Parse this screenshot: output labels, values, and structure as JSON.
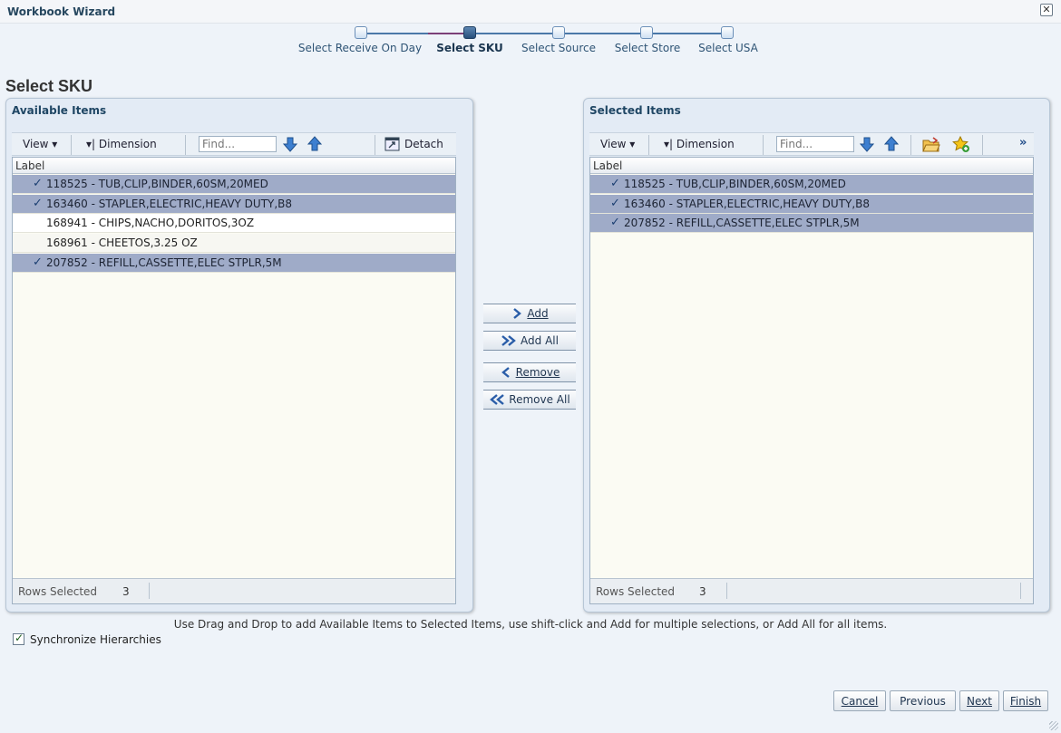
{
  "window": {
    "title": "Workbook Wizard"
  },
  "train": {
    "steps": [
      {
        "label": "Select Receive On Day"
      },
      {
        "label": "Select SKU"
      },
      {
        "label": "Select Source"
      },
      {
        "label": "Select Store"
      },
      {
        "label": "Select USA"
      }
    ],
    "current_step": "Select SKU"
  },
  "page": {
    "title": "Select SKU"
  },
  "available": {
    "title": "Available Items",
    "toolbar": {
      "view": "View ▾",
      "dimension": "Dimension",
      "find_placeholder": "Find...",
      "detach": "Detach"
    },
    "column_header": "Label",
    "rows": [
      {
        "label": "118525 - TUB,CLIP,BINDER,60SM,20MED",
        "selected": true
      },
      {
        "label": "163460 - STAPLER,ELECTRIC,HEAVY DUTY,B8",
        "selected": true
      },
      {
        "label": "168941 - CHIPS,NACHO,DORITOS,3OZ",
        "selected": false
      },
      {
        "label": "168961 - CHEETOS,3.25 OZ",
        "selected": false
      },
      {
        "label": "207852 - REFILL,CASSETTE,ELEC STPLR,5M",
        "selected": true
      }
    ],
    "footer": {
      "rows_selected_label": "Rows Selected",
      "rows_selected_value": "3"
    }
  },
  "selected": {
    "title": "Selected Items",
    "toolbar": {
      "view": "View ▾",
      "dimension": "Dimension",
      "find_placeholder": "Find..."
    },
    "column_header": "Label",
    "rows": [
      {
        "label": "118525 - TUB,CLIP,BINDER,60SM,20MED",
        "selected": true
      },
      {
        "label": "163460 - STAPLER,ELECTRIC,HEAVY DUTY,B8",
        "selected": true
      },
      {
        "label": "207852 - REFILL,CASSETTE,ELEC STPLR,5M",
        "selected": true
      }
    ],
    "footer": {
      "rows_selected_label": "Rows Selected",
      "rows_selected_value": "3"
    }
  },
  "shuttle": {
    "add": "Add",
    "add_all": "Add All",
    "remove": "Remove",
    "remove_all": "Remove All"
  },
  "hint": "Use Drag and Drop to add Available Items to Selected Items, use shift-click and Add for multiple selections, or Add All for all items.",
  "sync": {
    "label": "Synchronize Hierarchies",
    "checked": true
  },
  "buttons": {
    "cancel": "Cancel",
    "previous": "Previous",
    "next": "Next",
    "finish": "Finish"
  },
  "colors": {
    "accent": "#2f5475",
    "row_selected": "#9fabc8",
    "train_done": "#7b3f78"
  }
}
